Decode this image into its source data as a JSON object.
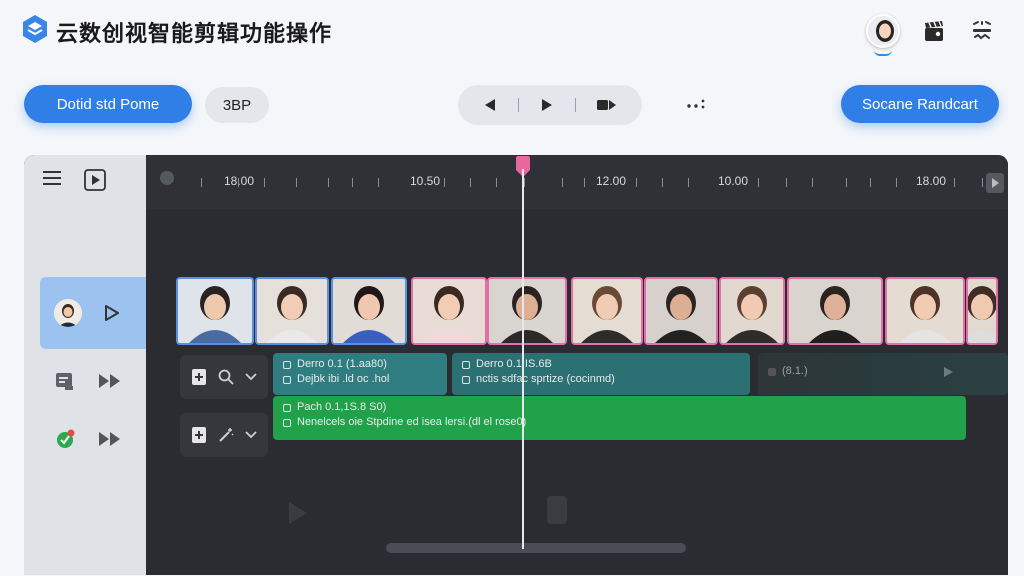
{
  "header": {
    "title": "云数创视智能剪辑功能操作",
    "logo_icon": "stack-logo-icon",
    "avatar_icon": "user-avatar-icon",
    "clapper_icon": "clapperboard-icon",
    "menu_icon": "grid-menu-icon"
  },
  "toolbar": {
    "primary_label": "Dotid std Pome",
    "chip_label": "3BP",
    "secondary_label": "Socane Randcart",
    "more_icon": "more-dots-icon",
    "player": {
      "prev_icon": "previous-icon",
      "play_icon": "play-icon",
      "next_icon": "next-frame-icon"
    }
  },
  "timeline": {
    "ruler_labels": [
      "18.00",
      "10.50",
      "12.00",
      "10.00",
      "18.00"
    ],
    "clips": [
      {
        "line1": "Derro 0.1 (1.aa80)",
        "line2": "Dejbk ibi .ld oc .hol"
      },
      {
        "line1": "Derro 0.1.IS.6B",
        "line2": "nctis sdfac sprtize (cocinmd)"
      },
      {
        "line1": "(8.1.)",
        "line2": ""
      },
      {
        "line1": "Pach 0.1,1S.8 S0)",
        "line2": "Nenelcels oie Stpdine ed isea lersi.(dl el rose0)"
      }
    ]
  },
  "colors": {
    "accent": "#2f7fe6",
    "panel_bg": "#2a2c31",
    "playhead": "#e8679e",
    "clip_teal": "#2f7d80",
    "clip_green": "#21a24a",
    "thumb_blue_border": "#5c8fe0",
    "thumb_pink_border": "#e26fa8"
  }
}
